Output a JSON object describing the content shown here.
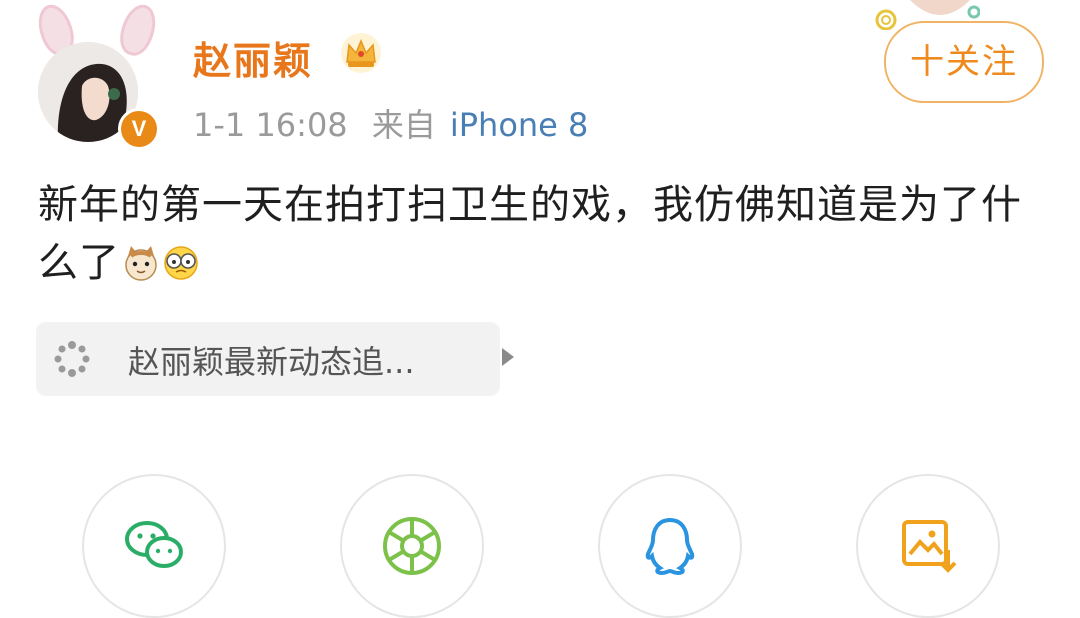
{
  "post": {
    "username": "赵丽颖",
    "timestamp": "1-1 16:08",
    "source_prefix": "来自",
    "source": "iPhone 8",
    "text": "新年的第一天在拍打扫卫生的戏，我仿佛知道是为了什么了"
  },
  "header": {
    "follow_label": "十关注"
  },
  "topic": {
    "label": "赵丽颖最新动态追..."
  },
  "share_targets": [
    "wechat-icon",
    "moments-icon",
    "qq-icon",
    "save-image-icon"
  ],
  "colors": {
    "accent": "#e8761a",
    "verified": "#e98a17",
    "link": "#4a7fb5",
    "follow_border": "#f0b466"
  }
}
